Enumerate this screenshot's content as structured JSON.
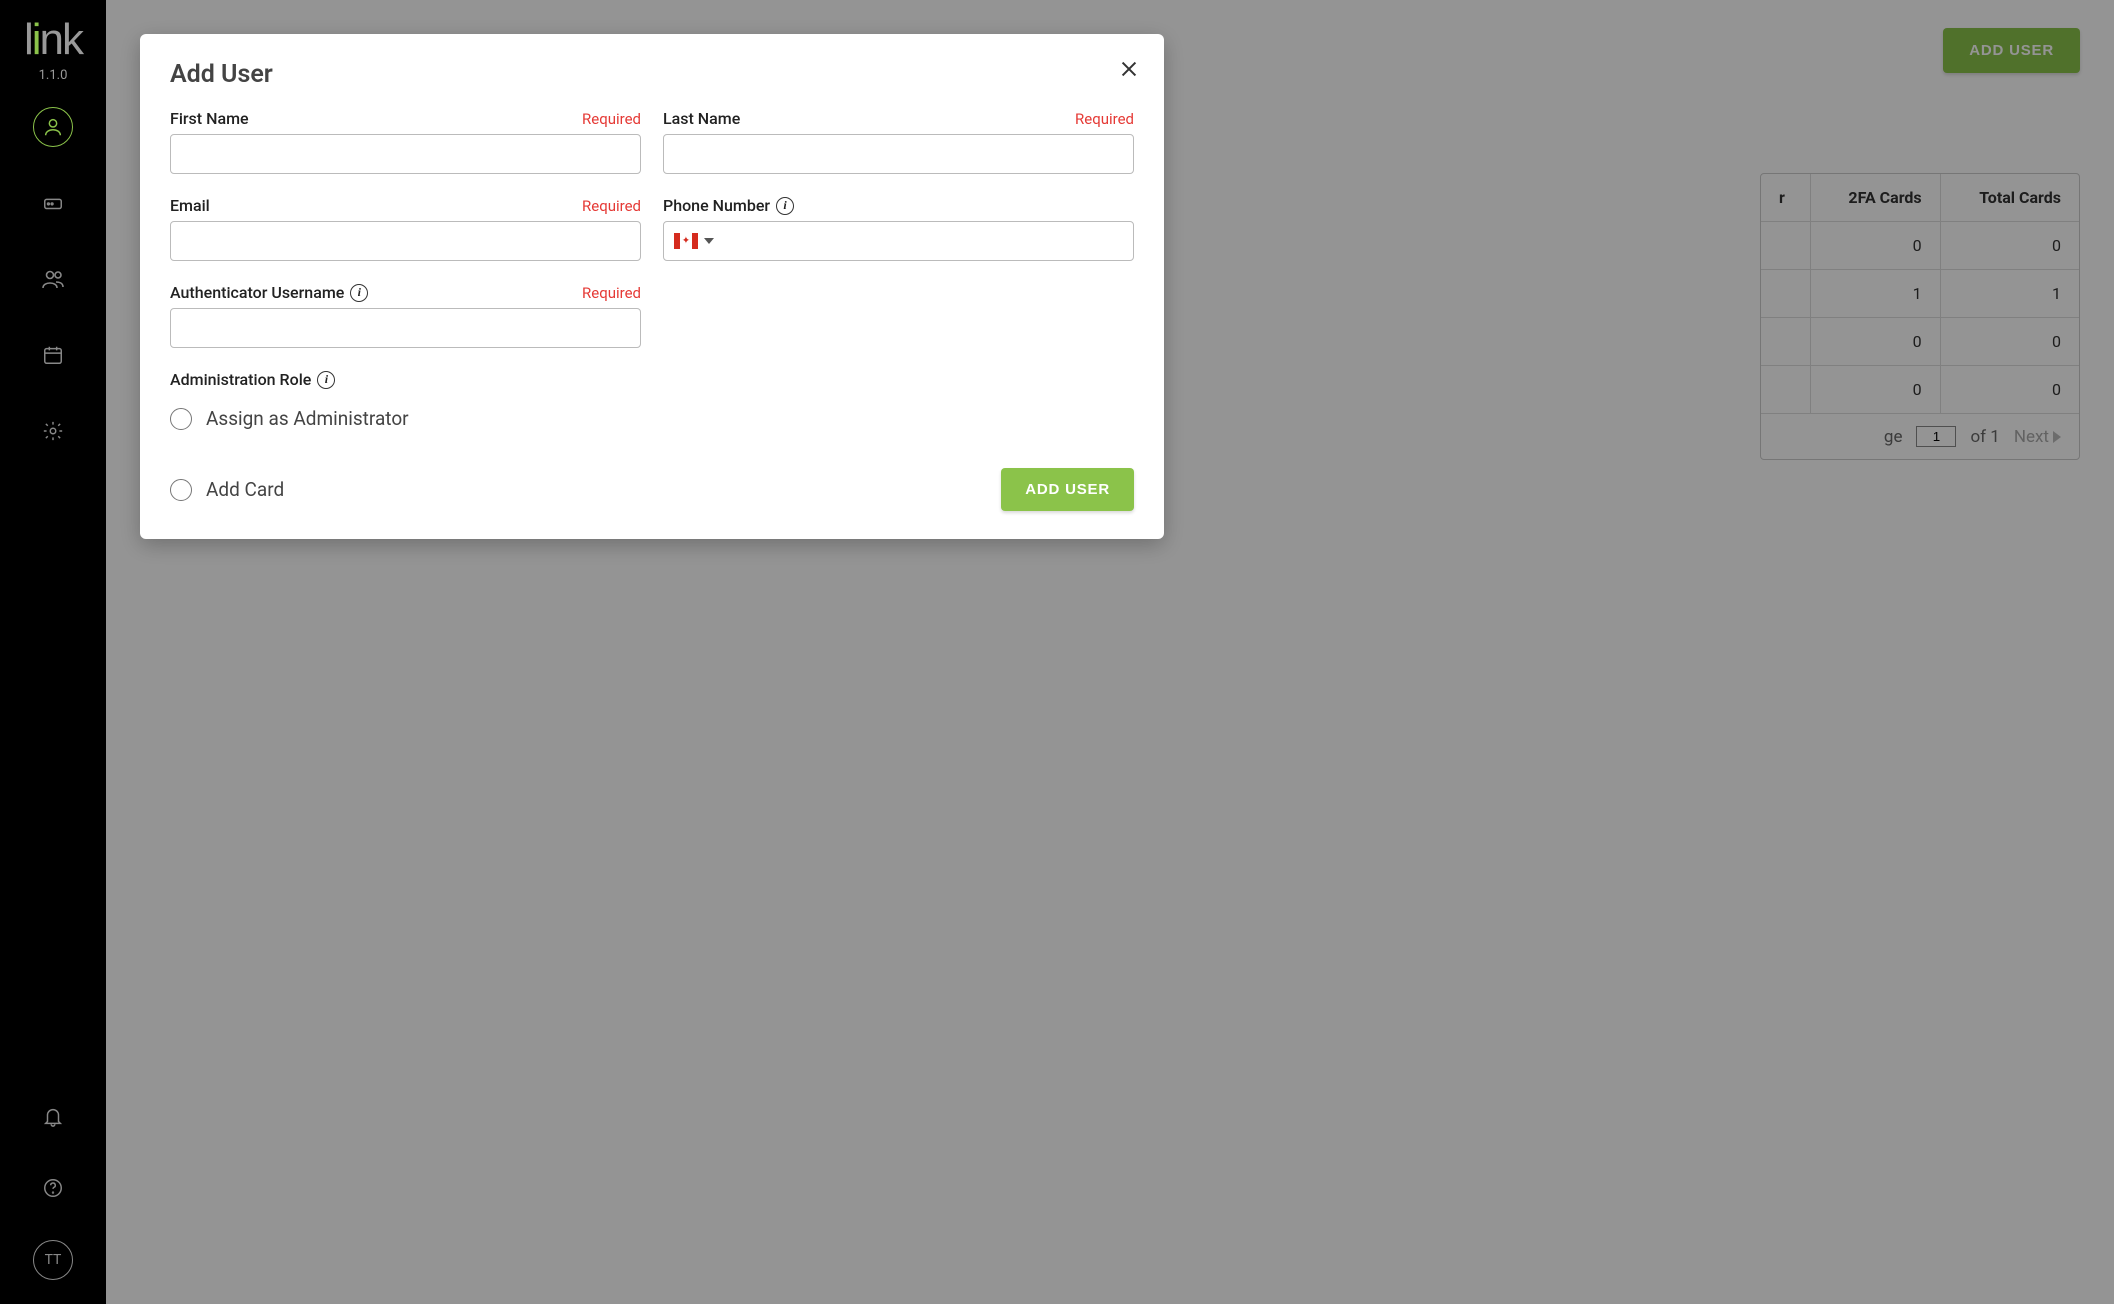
{
  "app": {
    "logo_text": "link",
    "version": "1.1.0",
    "avatar_initials": "TT"
  },
  "topbar": {
    "add_user": "ADD USER"
  },
  "table": {
    "headers": {
      "c1": "r",
      "c2": "2FA Cards",
      "c3": "Total Cards"
    },
    "rows": [
      {
        "c1": "",
        "c2": "0",
        "c3": "0"
      },
      {
        "c1": "",
        "c2": "1",
        "c3": "1"
      },
      {
        "c1": "",
        "c2": "0",
        "c3": "0"
      },
      {
        "c1": "",
        "c2": "0",
        "c3": "0"
      }
    ],
    "pager": {
      "page_label": "ge",
      "page": "1",
      "of": "of 1",
      "next": "Next"
    }
  },
  "modal": {
    "title": "Add User",
    "required": "Required",
    "first_name": "First Name",
    "last_name": "Last Name",
    "email": "Email",
    "phone": "Phone Number",
    "auth_user": "Authenticator Username",
    "admin_role": "Administration Role",
    "assign_admin": "Assign as Administrator",
    "add_card": "Add Card",
    "submit": "ADD USER",
    "country": "CA"
  }
}
